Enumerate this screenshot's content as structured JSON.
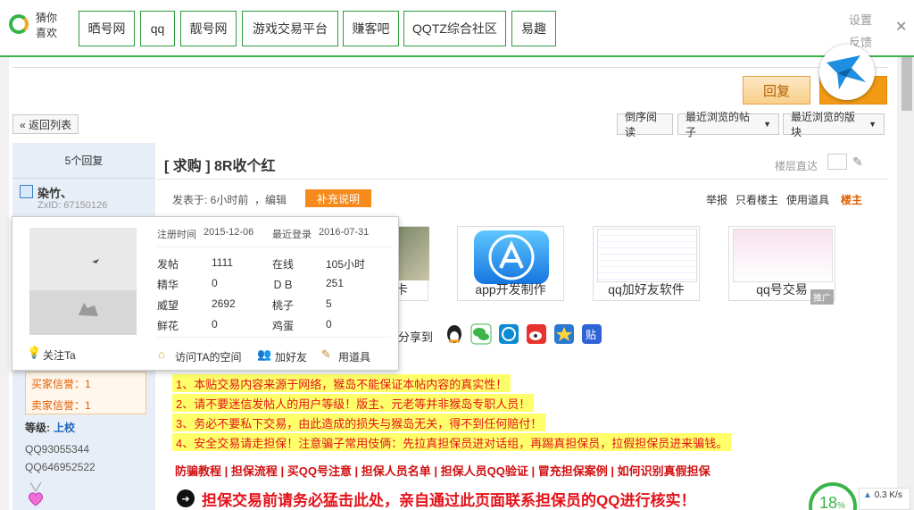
{
  "topbar": {
    "guess_label": "猜你喜欢",
    "chips": [
      "晒号网",
      "qq",
      "靓号网",
      "游戏交易平台",
      "赚客吧",
      "QQTZ综合社区",
      "易趣"
    ],
    "settings": "设置",
    "feedback": "反馈",
    "close": "✕"
  },
  "toolbar": {
    "reply": "回复",
    "back": "« 返回列表",
    "reverse": "倒序阅读",
    "recent_posts": "最近浏览的帖子",
    "recent_boards": "最近浏览的版块"
  },
  "sidebar": {
    "reply_count": "5个回复",
    "username": "染竹、",
    "zxid": "ZxID: 67150126",
    "buyer_credit": "买家信誉：1",
    "seller_credit": "卖家信誉：1",
    "level_label": "等级:",
    "level_value": "上校",
    "qq_text": "QQ93055344 QQ646952522"
  },
  "post": {
    "title": "[ 求购 ] 8R收个红",
    "floor_jump": "楼层直达",
    "meta": "发表于: 6小时前",
    "edit": "，编辑",
    "supplement": "补充说明",
    "actions": {
      "report": "举报",
      "author_only": "只看楼主",
      "tools": "使用道具",
      "floor": "楼主"
    }
  },
  "ads": {
    "ad1": "卡",
    "ad2": "app开发制作",
    "ad3": "qq加好友软件",
    "ad4": "qq号交易",
    "mark": "推广"
  },
  "share": {
    "label": "分享到"
  },
  "notices": [
    "1、本贴交易内容来源于网络，猴岛不能保证本帖内容的真实性！",
    "2、请不要迷信发帖人的用户等级！版主、元老等并非猴岛专职人员！",
    "3、务必不要私下交易，由此造成的损失与猴岛无关，得不到任何赔付！",
    "4、安全交易请走担保！注意骗子常用伎俩：先拉真担保员进对话组，再踢真担保员，拉假担保员进来骗钱。"
  ],
  "links": "防骗教程 | 担保流程 | 买QQ号注意 | 担保人员名单 | 担保人员QQ验证 | 冒充担保案例 | 如何识别真假担保",
  "big_warning": "担保交易前请务必猛击此处，亲自通过此页面联系担保员的QQ进行核实！",
  "card": {
    "reg_label": "注册时间",
    "reg_value": "2015-12-06",
    "last_label": "最近登录",
    "last_value": "2016-07-31",
    "stats": [
      {
        "k1": "发帖",
        "v1": "1111",
        "k2": "在线",
        "v2": "105小时"
      },
      {
        "k1": "精华",
        "v1": "0",
        "k2": "ＤＢ",
        "v2": "251"
      },
      {
        "k1": "威望",
        "v1": "2692",
        "k2": "桃子",
        "v2": "5"
      },
      {
        "k1": "鲜花",
        "v1": "0",
        "k2": "鸡蛋",
        "v2": "0"
      }
    ],
    "follow": "关注Ta",
    "space": "访问TA的空间",
    "friend": "加好友",
    "tool": "用道具"
  },
  "speed": {
    "percent": "18",
    "unit": "%",
    "rate": "0.3 K/s"
  },
  "colors": {
    "accent_green": "#3bb44a",
    "warn_red": "#e4121a",
    "orange": "#f68a1b"
  }
}
